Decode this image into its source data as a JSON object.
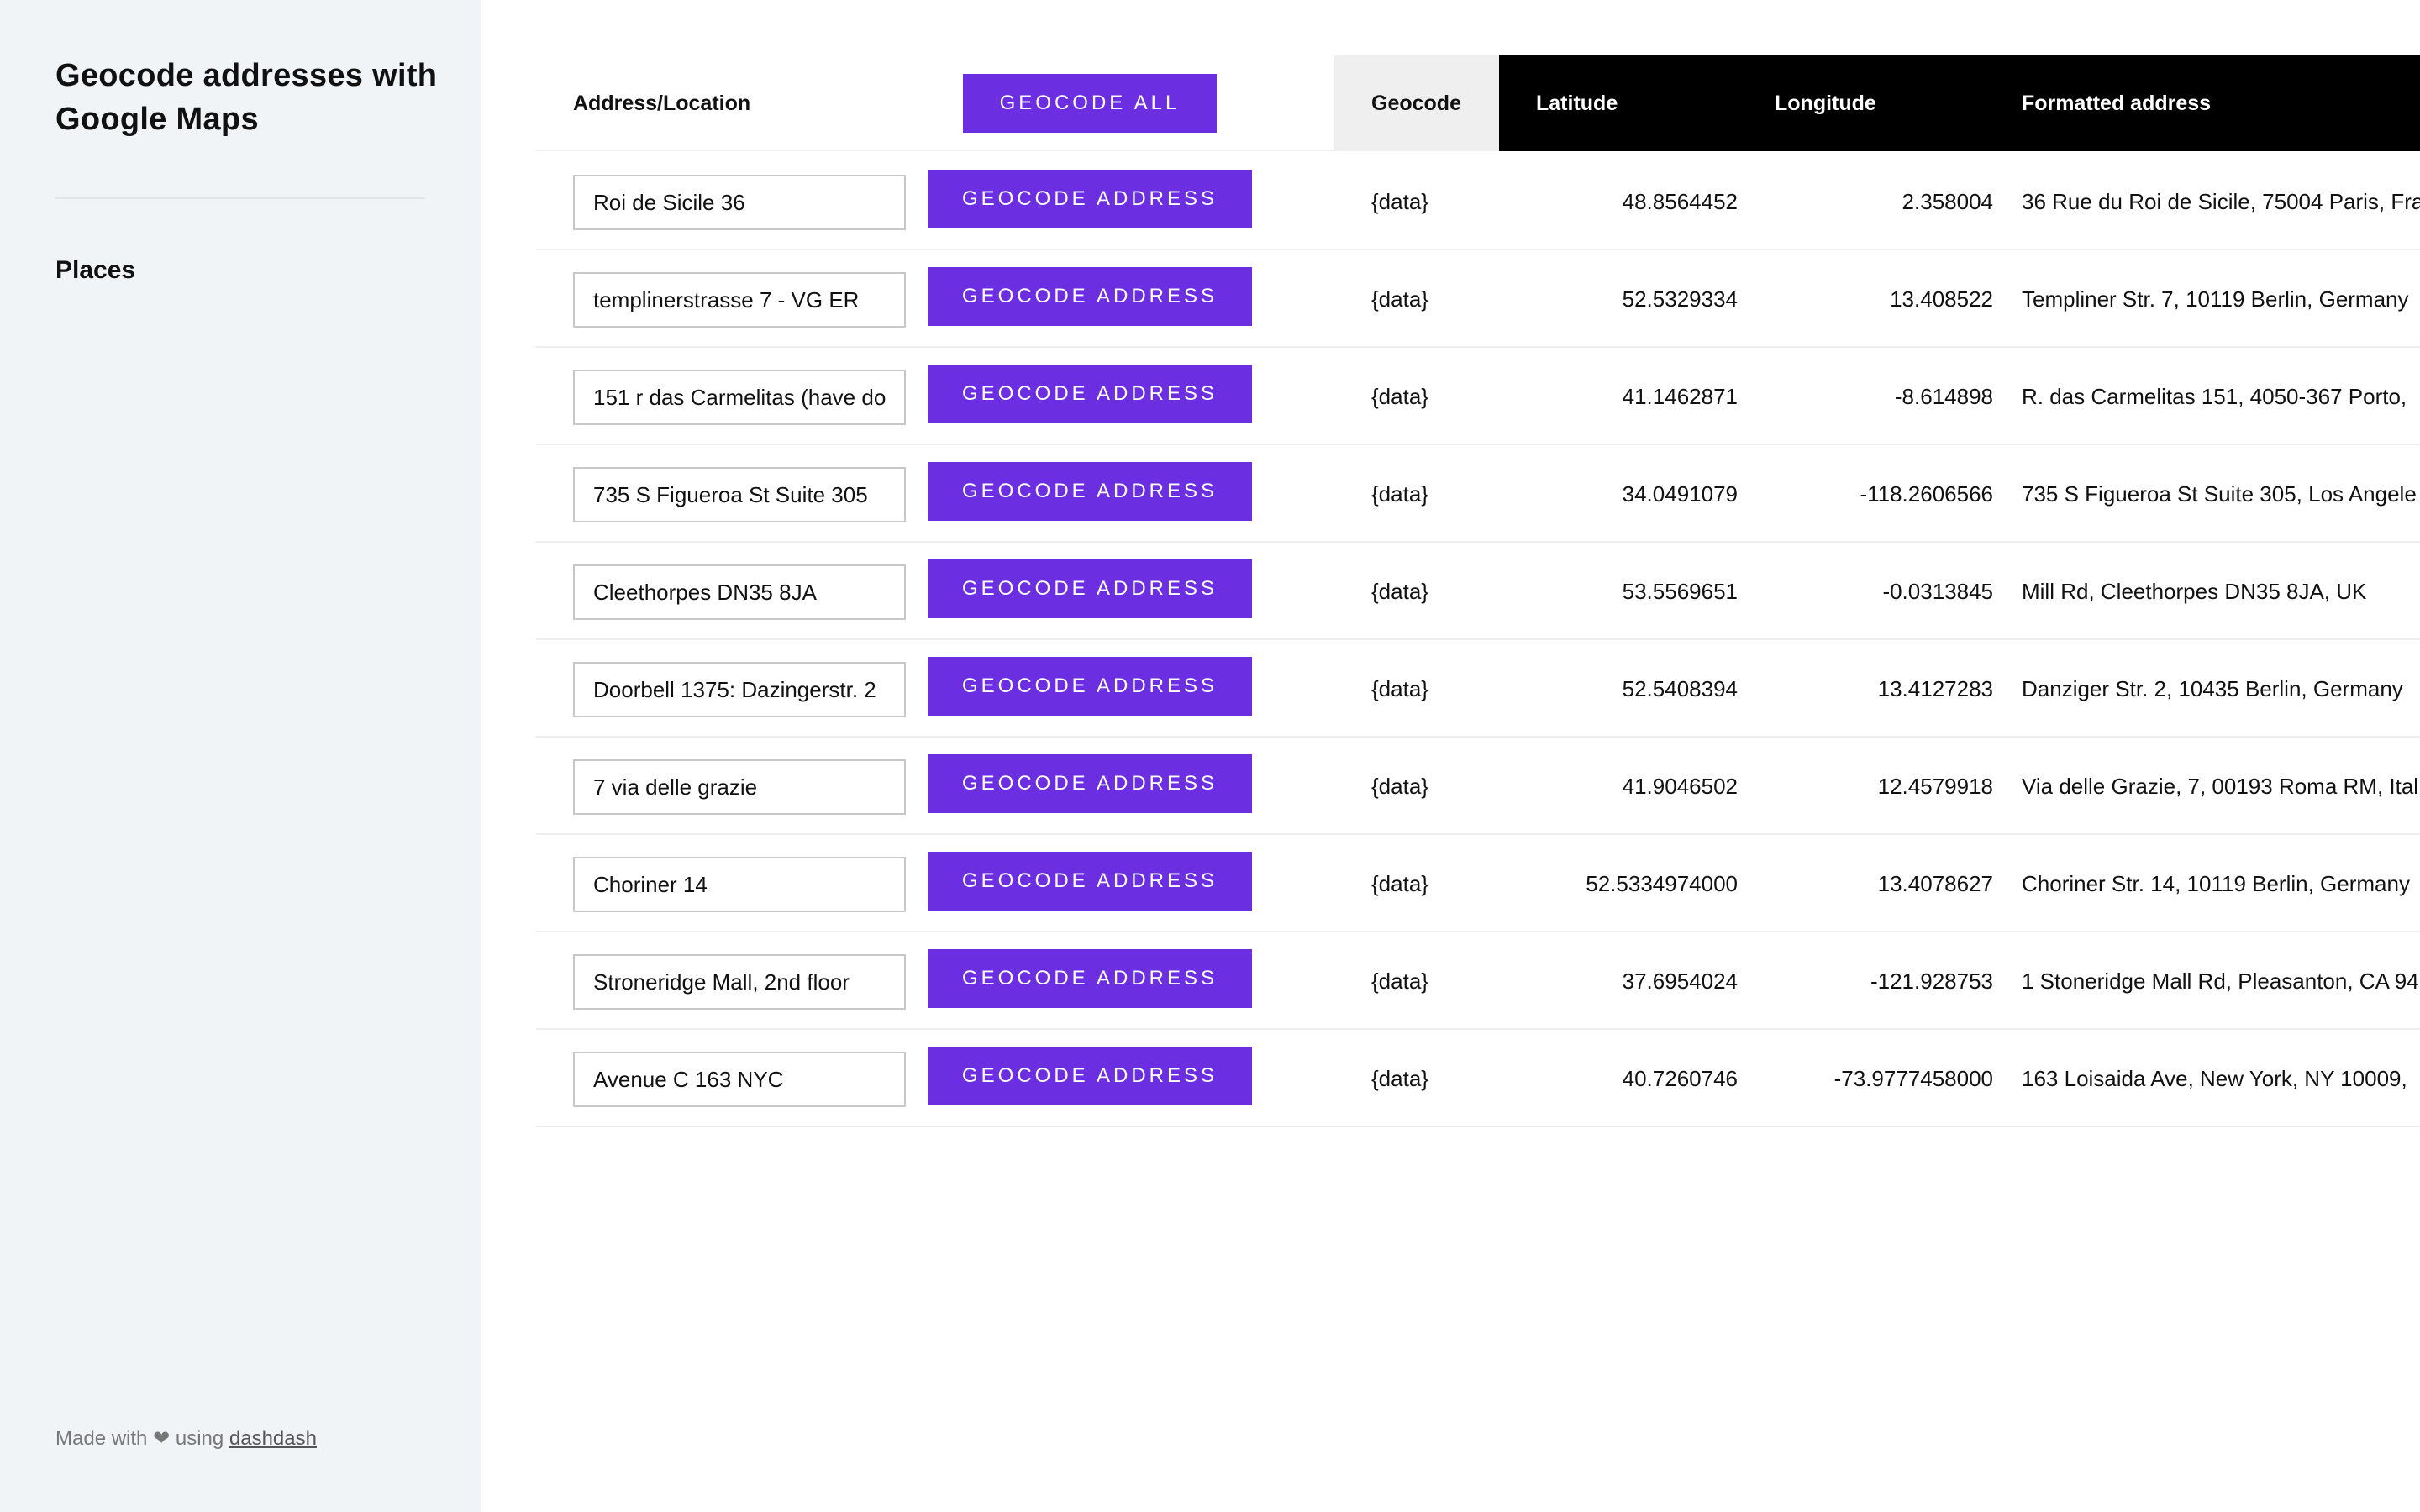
{
  "sidebar": {
    "title": "Geocode addresses with Google Maps",
    "nav": {
      "places": "Places"
    },
    "footer": {
      "made_with": "Made with",
      "heart": "❤",
      "using": "using",
      "link": "dashdash"
    }
  },
  "table": {
    "headers": {
      "address": "Address/Location",
      "geocode_all": "GEOCODE ALL",
      "geocode": "Geocode",
      "latitude": "Latitude",
      "longitude": "Longitude",
      "formatted": "Formatted address"
    },
    "button_label": "GEOCODE ADDRESS",
    "rows": [
      {
        "address": "Roi de Sicile 36",
        "geocode": "{data}",
        "lat": "48.8564452",
        "lon": "2.358004",
        "formatted": "36 Rue du Roi de Sicile, 75004 Paris, Fra"
      },
      {
        "address": "templinerstrasse 7 - VG ER",
        "geocode": "{data}",
        "lat": "52.5329334",
        "lon": "13.408522",
        "formatted": "Templiner Str. 7, 10119 Berlin, Germany"
      },
      {
        "address": "151 r das Carmelitas (have do",
        "geocode": "{data}",
        "lat": "41.1462871",
        "lon": "-8.614898",
        "formatted": "R. das Carmelitas 151, 4050-367 Porto,"
      },
      {
        "address": "735 S Figueroa St Suite 305",
        "geocode": "{data}",
        "lat": "34.0491079",
        "lon": "-118.2606566",
        "formatted": "735 S Figueroa St Suite 305, Los Angele"
      },
      {
        "address": "Cleethorpes DN35 8JA",
        "geocode": "{data}",
        "lat": "53.5569651",
        "lon": "-0.0313845",
        "formatted": "Mill Rd, Cleethorpes DN35 8JA, UK"
      },
      {
        "address": "Doorbell 1375: Dazingerstr. 2",
        "geocode": "{data}",
        "lat": "52.5408394",
        "lon": "13.4127283",
        "formatted": "Danziger Str. 2, 10435 Berlin, Germany"
      },
      {
        "address": "7 via delle grazie",
        "geocode": "{data}",
        "lat": "41.9046502",
        "lon": "12.4579918",
        "formatted": "Via delle Grazie, 7, 00193 Roma RM, Ital"
      },
      {
        "address": "Choriner 14",
        "geocode": "{data}",
        "lat": "52.5334974000",
        "lon": "13.4078627",
        "formatted": "Choriner Str. 14, 10119 Berlin, Germany"
      },
      {
        "address": "Stroneridge Mall, 2nd floor",
        "geocode": "{data}",
        "lat": "37.6954024",
        "lon": "-121.928753",
        "formatted": "1 Stoneridge Mall Rd, Pleasanton, CA 94"
      },
      {
        "address": "Avenue C 163 NYC",
        "geocode": "{data}",
        "lat": "40.7260746",
        "lon": "-73.9777458000",
        "formatted": "163 Loisaida Ave, New York, NY 10009,"
      }
    ]
  },
  "colors": {
    "accent": "#6b2ee0",
    "sidebar_bg": "#f1f4f7",
    "header_black": "#000000"
  }
}
